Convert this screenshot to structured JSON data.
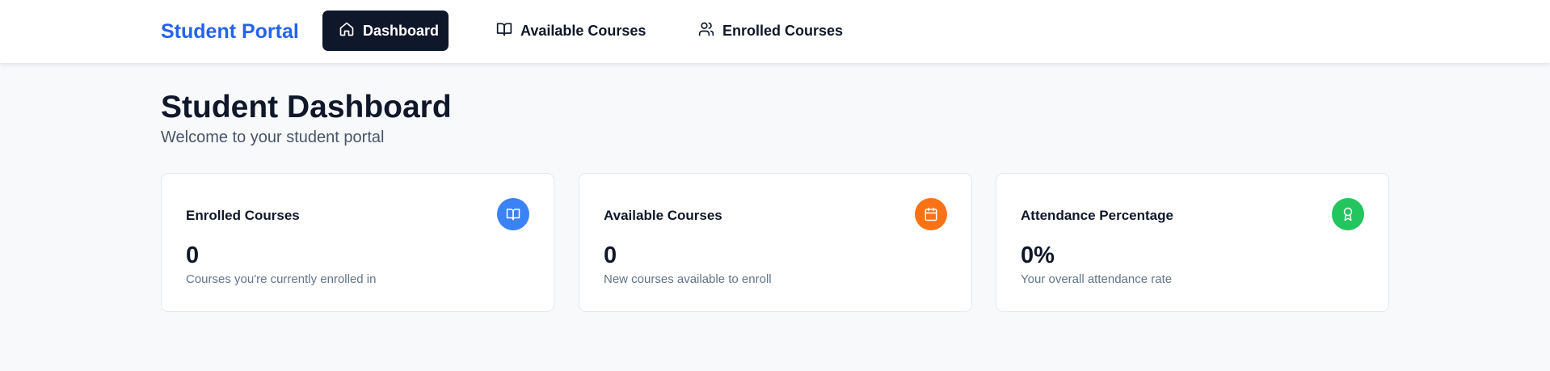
{
  "nav": {
    "brand": "Student Portal",
    "items": [
      {
        "label": "Dashboard",
        "icon": "home-icon",
        "active": true
      },
      {
        "label": "Available Courses",
        "icon": "book-open-icon",
        "active": false
      },
      {
        "label": "Enrolled Courses",
        "icon": "users-icon",
        "active": false
      }
    ]
  },
  "header": {
    "title": "Student Dashboard",
    "subtitle": "Welcome to your student portal"
  },
  "cards": [
    {
      "title": "Enrolled Courses",
      "value": "0",
      "description": "Courses you're currently enrolled in",
      "icon": "book-open-icon",
      "color": "#3b82f6"
    },
    {
      "title": "Available Courses",
      "value": "0",
      "description": "New courses available to enroll",
      "icon": "calendar-icon",
      "color": "#f97316"
    },
    {
      "title": "Attendance Percentage",
      "value": "0%",
      "description": "Your overall attendance rate",
      "icon": "award-icon",
      "color": "#22c55e"
    }
  ],
  "colors": {
    "brand": "#2563eb",
    "nav_active_bg": "#0f172a",
    "page_bg": "#f8f9fb"
  }
}
